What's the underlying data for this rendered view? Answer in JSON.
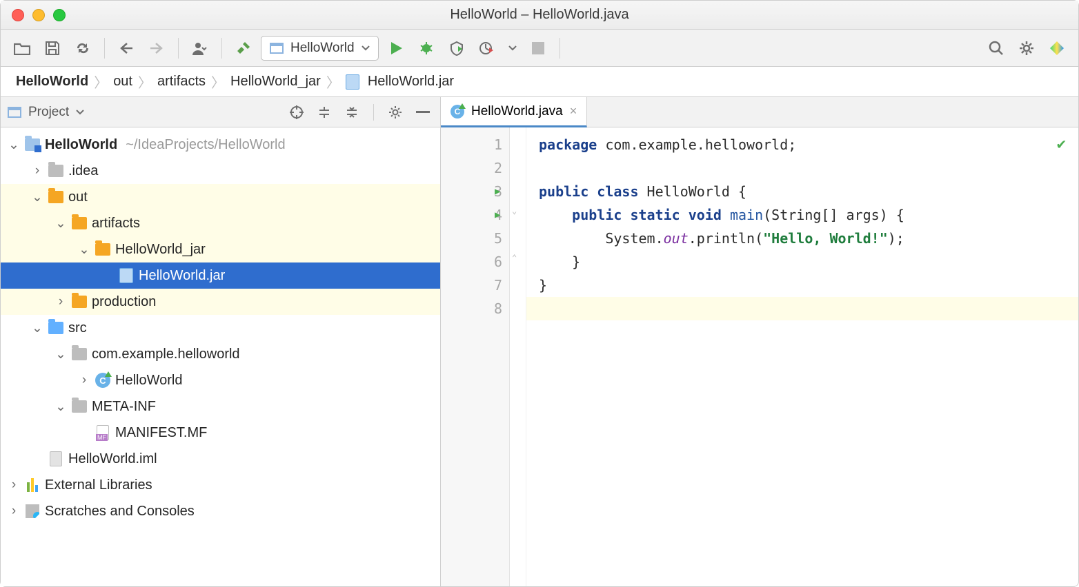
{
  "window": {
    "title": "HelloWorld – HelloWorld.java"
  },
  "toolbar": {
    "run_config": "HelloWorld"
  },
  "breadcrumb": {
    "items": [
      "HelloWorld",
      "out",
      "artifacts",
      "HelloWorld_jar",
      "HelloWorld.jar"
    ]
  },
  "sidebar": {
    "title": "Project",
    "root": {
      "name": "HelloWorld",
      "path": "~/IdeaProjects/HelloWorld"
    },
    "items": {
      "idea": ".idea",
      "out": "out",
      "artifacts": "artifacts",
      "jar_folder": "HelloWorld_jar",
      "jar_file": "HelloWorld.jar",
      "production": "production",
      "src": "src",
      "pkg": "com.example.helloworld",
      "cls": "HelloWorld",
      "meta": "META-INF",
      "manifest": "MANIFEST.MF",
      "iml": "HelloWorld.iml",
      "ext": "External Libraries",
      "scratch": "Scratches and Consoles"
    }
  },
  "editor": {
    "tab": "HelloWorld.java",
    "lines": [
      "1",
      "2",
      "3",
      "4",
      "5",
      "6",
      "7",
      "8"
    ],
    "code": {
      "l1a": "package",
      "l1b": " com.example.helloworld;",
      "l3a": "public class",
      "l3b": " HelloWorld {",
      "l4a": "public static void",
      "l4b": "main",
      "l4c": "(String[] args) {",
      "l5a": "System.",
      "l5b": "out",
      "l5c": ".println(",
      "l5d": "\"Hello, World!\"",
      "l5e": ");",
      "l6": "}",
      "l7": "}"
    }
  }
}
